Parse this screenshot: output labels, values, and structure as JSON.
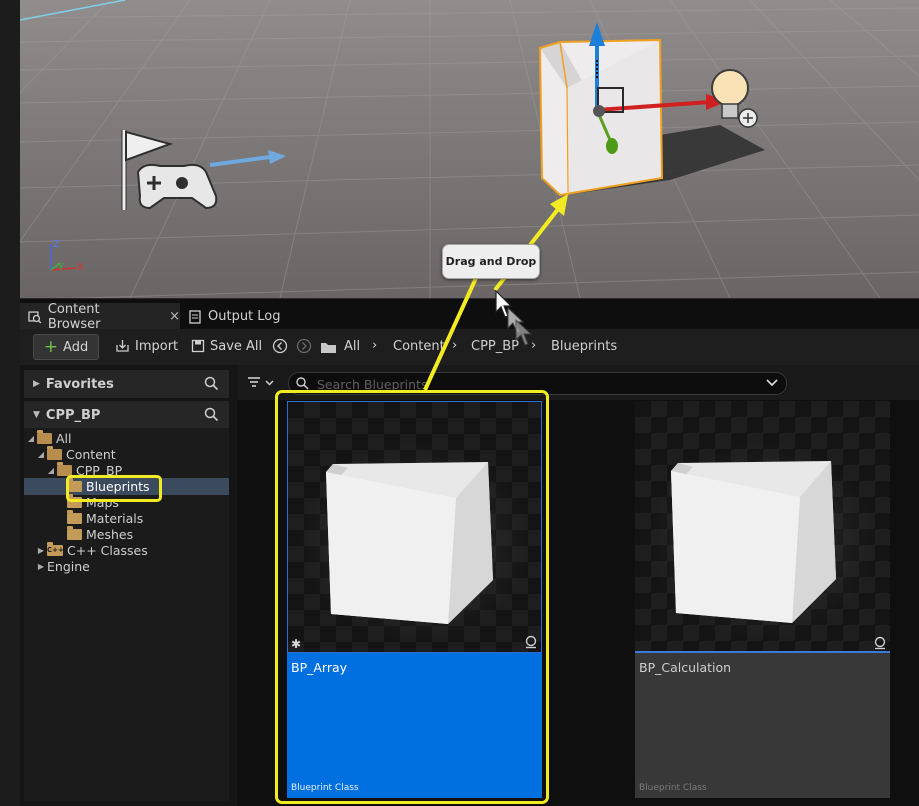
{
  "viewport": {
    "axis_labels": {
      "z": "Z",
      "y": "Y",
      "x": "X"
    }
  },
  "tabs": [
    {
      "label": "Content Browser",
      "close": "×"
    },
    {
      "label": "Output Log"
    }
  ],
  "toolbar": {
    "add_label": "Add",
    "import_label": "Import",
    "save_all_label": "Save All",
    "breadcrumbs": [
      "All",
      "Content",
      "CPP_BP",
      "Blueprints"
    ],
    "separator": "›"
  },
  "sidebar": {
    "favorites_label": "Favorites",
    "project_label": "CPP_BP",
    "tree": {
      "all": "All",
      "content": "Content",
      "cpp_bp": "CPP_BP",
      "blueprints": "Blueprints",
      "maps": "Maps",
      "materials": "Materials",
      "meshes": "Meshes",
      "cpp_classes": "C++ Classes",
      "engine": "Engine",
      "cpp_badge": "C++"
    }
  },
  "search": {
    "placeholder": "Search Blueprints"
  },
  "assets": [
    {
      "name": "BP_Array",
      "type": "Blueprint Class",
      "selected": true
    },
    {
      "name": "BP_Calculation",
      "type": "Blueprint Class",
      "selected": false
    }
  ],
  "annotation": {
    "tooltip": "Drag and Drop"
  },
  "colors": {
    "selection": "#0070e0",
    "highlight": "#f3eb22",
    "folder": "#c49a58",
    "actor_outline": "#f0a020"
  }
}
